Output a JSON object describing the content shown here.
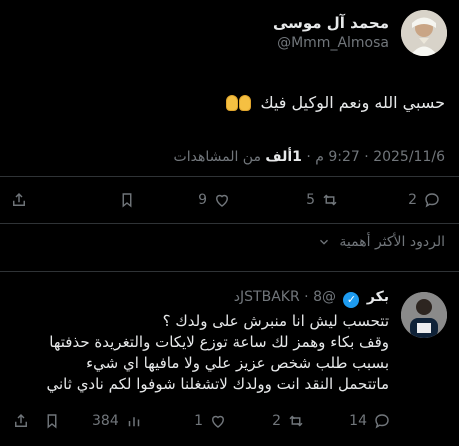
{
  "tweet": {
    "author_name": "محمد آل موسى",
    "author_handle": "@Mmm_Almosa",
    "text": "حسبي الله ونعم الوكيل فيك",
    "emoji": "praying-hands-emoji",
    "date": "2025/11/6",
    "time": "9:27 م",
    "views_count": "1ألف",
    "views_label": "من المشاهدات",
    "stats": {
      "replies": "2",
      "retweets": "5",
      "likes": "9"
    }
  },
  "replies_filter": {
    "label": "الردود الأكثر أهمية",
    "icon": "chevron-down-icon"
  },
  "reply": {
    "author_name": "بكر",
    "verified": true,
    "handle": "@JSTBAKR",
    "time": "8د",
    "lines": [
      "تتحسب ليش انا منبرش على ولدك ؟",
      "وقف بكاء وهمز لك ساعة توزع لايكات والتغريدة حذفتها",
      "بسبب طلب شخص عزيز علي ولا مافيها اي شيء",
      "ماتتحمل النقد انت وولدك لاتشغلنا شوفوا لكم نادي ثاني"
    ],
    "stats": {
      "replies": "14",
      "retweets": "2",
      "likes": "1",
      "views": "384"
    }
  },
  "colors": {
    "background": "#000000",
    "text": "#e7e9ea",
    "muted": "#71767b",
    "divider": "#2f3336",
    "verified": "#1d9bf0"
  }
}
